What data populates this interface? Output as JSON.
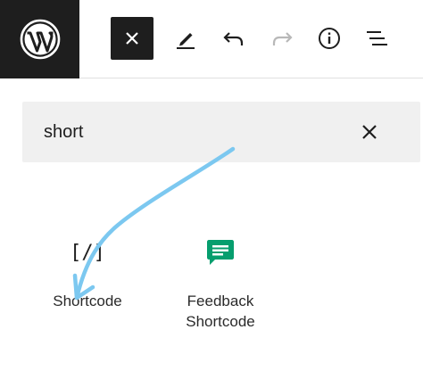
{
  "toolbar": {
    "logo_icon": "wordpress-logo-icon",
    "close_icon": "close-icon",
    "edit_icon": "pencil-icon",
    "undo_icon": "undo-icon",
    "redo_icon": "redo-icon",
    "info_icon": "info-icon",
    "outline_icon": "list-view-icon"
  },
  "search": {
    "value": "short",
    "clear_icon": "close-icon"
  },
  "blocks": [
    {
      "label": "Shortcode",
      "icon": "shortcode-icon",
      "glyph": "[/]"
    },
    {
      "label": "Feedback Shortcode",
      "label_line1": "Feedback",
      "label_line2": "Shortcode",
      "icon": "feedback-icon",
      "icon_color": "#069e6e"
    }
  ],
  "annotation": {
    "arrow_color": "#7cc8f0"
  }
}
